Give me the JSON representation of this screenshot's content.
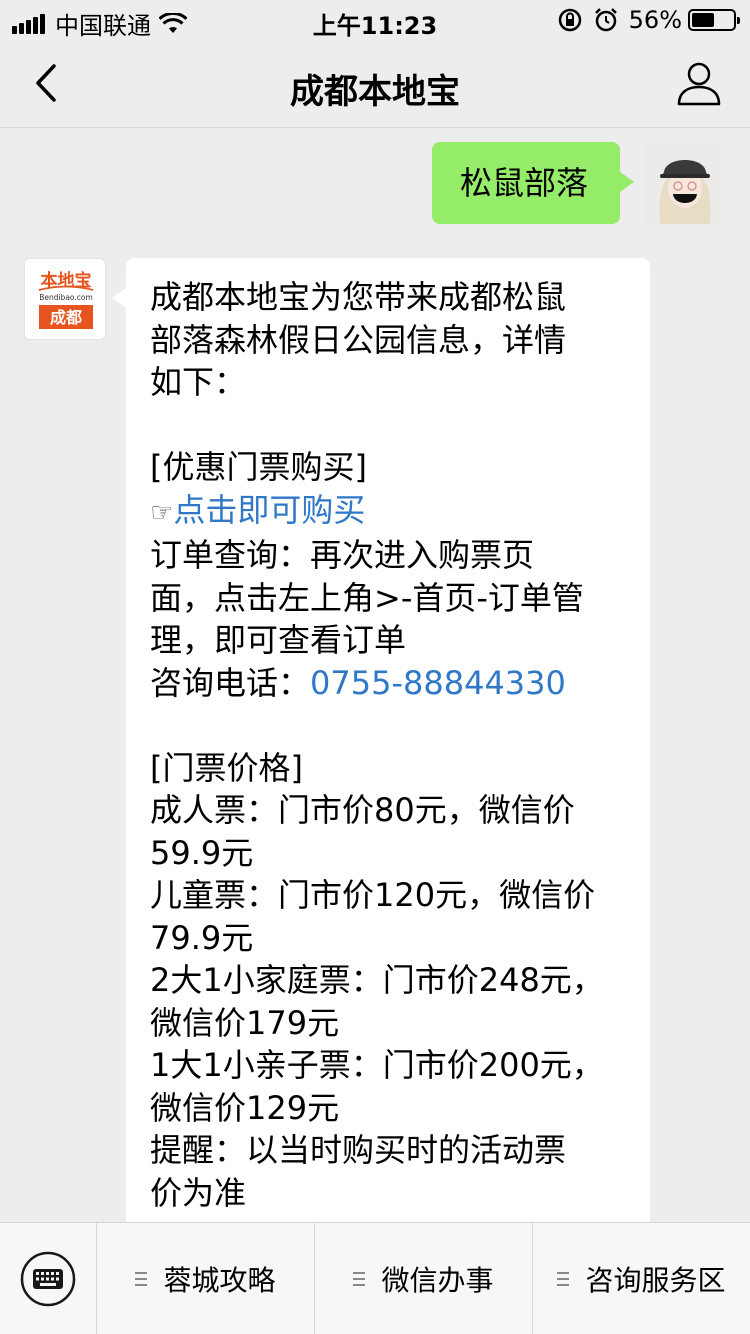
{
  "status_bar": {
    "carrier": "中国联通",
    "time": "上午11:23",
    "battery_percent_label": "56%",
    "battery_level": 0.56,
    "icons": [
      "signal-icon",
      "wifi-icon",
      "orientation-lock-icon",
      "alarm-icon",
      "battery-icon"
    ]
  },
  "nav": {
    "title": "成都本地宝",
    "back_icon": "chevron-left-icon",
    "profile_icon": "person-icon"
  },
  "chat": {
    "sent_message": "松鼠部落",
    "bot_logo": {
      "brand": "本地宝",
      "domain": "Bendibao.com",
      "city": "成都"
    },
    "received_message": {
      "intro": [
        "成都本地宝为您带来成都松鼠",
        "部落森林假日公园信息，详情",
        "如下："
      ],
      "ticket_header": "[优惠门票购买]",
      "hand_icon": "☞",
      "buy_link": "点击即可购买",
      "order_lines": [
        "订单查询：再次进入购票页",
        "面，点击左上角>-首页-订单管",
        "理，即可查看订单"
      ],
      "phone_label": "咨询电话：",
      "phone_number": "0755-88844330",
      "price_header": "[门票价格]",
      "price_lines": [
        "成人票：门市价80元，微信价",
        "59.9元",
        "儿童票：门市价120元，微信价",
        "79.9元",
        "2大1小家庭票：门市价248元，",
        "微信价179元",
        "1大1小亲子票：门市价200元，",
        "微信价129元",
        "提醒：以当时购买时的活动票",
        "价为准"
      ]
    }
  },
  "menu": {
    "keyboard_icon": "keyboard-icon",
    "items": [
      {
        "label": "蓉城攻略"
      },
      {
        "label": "微信办事"
      },
      {
        "label": "咨询服务区"
      }
    ]
  }
}
